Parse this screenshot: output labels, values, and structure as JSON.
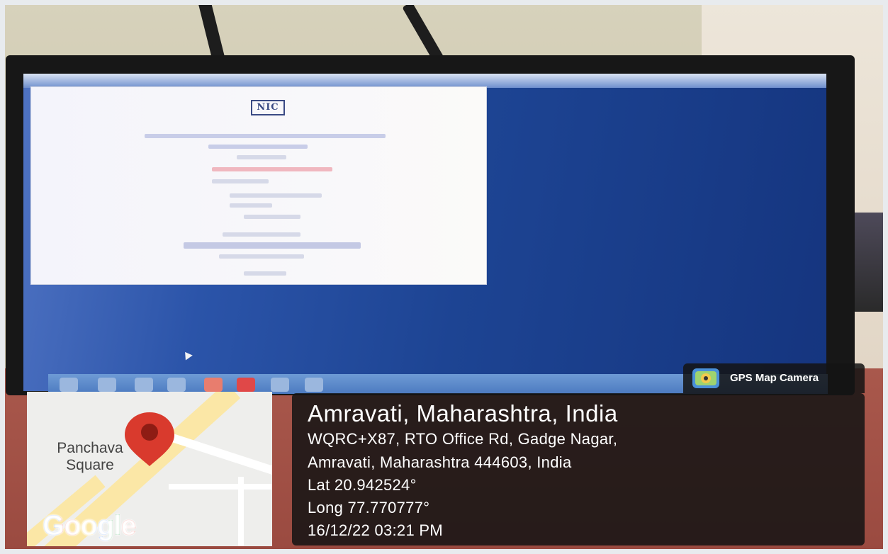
{
  "screen_window": {
    "logo_text": "NIC"
  },
  "map": {
    "place_label_line1": "Panchava",
    "place_label_line2": "Square",
    "provider": "Google",
    "colors": {
      "pin": "#d93a2d",
      "road": "#fbe7a6"
    }
  },
  "badge": {
    "app_name": "GPS Map Camera",
    "icon": "gps-map-camera-icon"
  },
  "location": {
    "title": "Amravati, Maharashtra, India",
    "address_line1": "WQRC+X87, RTO Office Rd, Gadge Nagar,",
    "address_line2": "Amravati, Maharashtra 444603, India",
    "latitude": "Lat 20.942524°",
    "longitude": "Long 77.770777°",
    "timestamp": "16/12/22 03:21 PM"
  }
}
